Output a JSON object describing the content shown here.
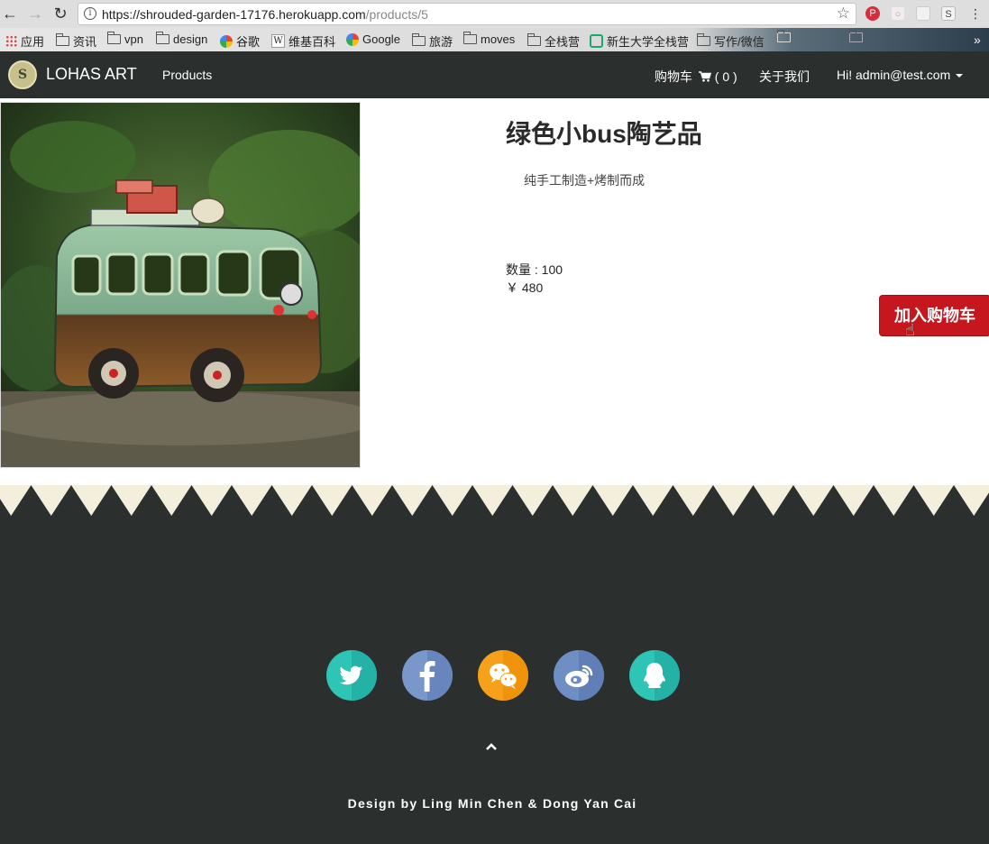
{
  "browser": {
    "url_host": "https://shrouded-garden-17176.herokuapp.com",
    "url_path": "/products/5",
    "bookmarks": [
      {
        "label": "应用",
        "icon": "apps-grid-icon"
      },
      {
        "label": "资讯",
        "icon": "folder-icon"
      },
      {
        "label": "vpn",
        "icon": "folder-icon"
      },
      {
        "label": "design",
        "icon": "folder-icon"
      },
      {
        "label": "谷歌",
        "icon": "google-icon"
      },
      {
        "label": "维基百科",
        "icon": "wikipedia-icon"
      },
      {
        "label": "Google",
        "icon": "google-icon"
      },
      {
        "label": "旅游",
        "icon": "folder-icon"
      },
      {
        "label": "moves",
        "icon": "folder-icon"
      },
      {
        "label": "全栈营",
        "icon": "folder-icon"
      },
      {
        "label": "新生大学全栈营",
        "icon": "xinsheng-icon"
      },
      {
        "label": "写作/微信",
        "icon": "folder-icon"
      }
    ]
  },
  "nav": {
    "brand": "LOHAS ART",
    "logo_letter": "S",
    "products": "Products",
    "cart": "购物车",
    "cart_count": "( 0 )",
    "about": "关于我们",
    "user": "Hi! admin@test.com"
  },
  "product": {
    "title": "绿色小bus陶艺品",
    "description": "纯手工制造+烤制而成",
    "quantity": "数量 : 100",
    "price": "￥ 480",
    "add_to_cart": "加入购物车"
  },
  "footer": {
    "social": [
      "twitter-icon",
      "facebook-icon",
      "wechat-icon",
      "weibo-icon",
      "qq-icon"
    ],
    "credit": "Design by Ling Min Chen & Dong Yan Cai"
  },
  "colors": {
    "nav_bg": "#2b302e",
    "button_red": "#c6171e",
    "zigzag_cream": "#f3efdc",
    "teal": "#2ec4b6",
    "fb_blue": "#6f8fc4",
    "wechat_orange": "#f7a11a"
  }
}
